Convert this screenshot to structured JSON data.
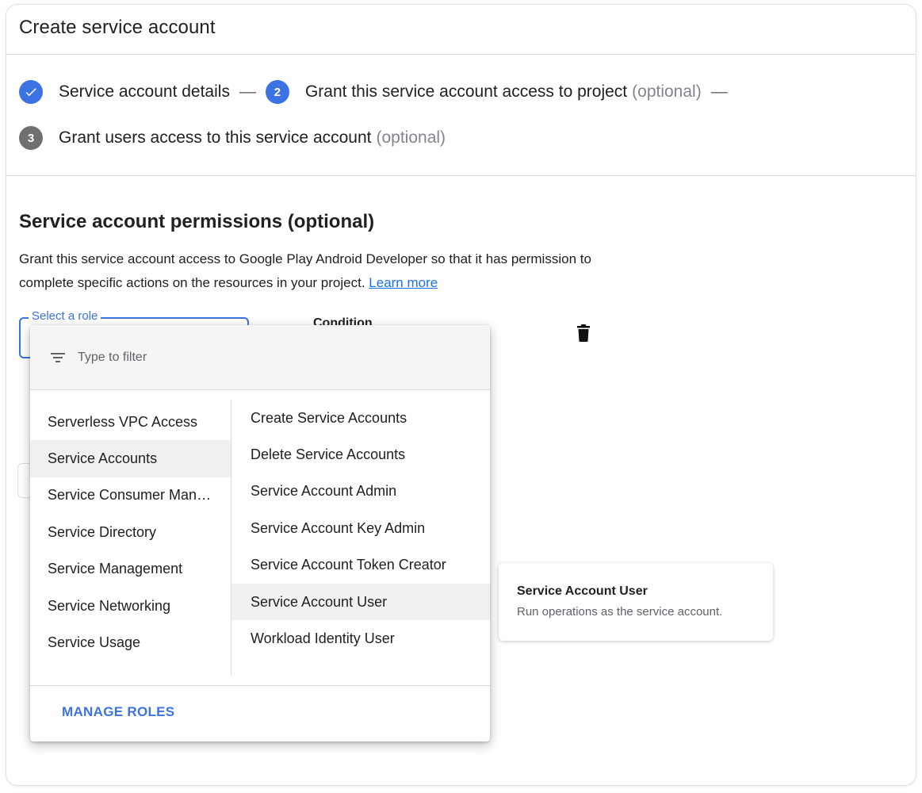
{
  "header": {
    "title": "Create service account"
  },
  "stepper": {
    "step1": {
      "label": "Service account details"
    },
    "separator": "—",
    "step2": {
      "number": "2",
      "label": "Grant this service account access to project",
      "optional": "(optional)"
    },
    "step3": {
      "number": "3",
      "label": "Grant users access to this service account",
      "optional": "(optional)"
    }
  },
  "permissions": {
    "title": "Service account permissions (optional)",
    "description": "Grant this service account access to Google Play Android Developer so that it has permission to complete specific actions on the resources in your project.",
    "learn_more": "Learn more",
    "role_label": "Select a role",
    "condition_label": "Condition"
  },
  "dropdown": {
    "filter_placeholder": "Type to filter",
    "services": [
      "Serverless VPC Access",
      "Service Accounts",
      "Service Consumer Man…",
      "Service Directory",
      "Service Management",
      "Service Networking",
      "Service Usage"
    ],
    "selected_service": "Service Accounts",
    "roles": [
      "Create Service Accounts",
      "Delete Service Accounts",
      "Service Account Admin",
      "Service Account Key Admin",
      "Service Account Token Creator",
      "Service Account User",
      "Workload Identity User"
    ],
    "selected_role": "Service Account User",
    "manage_roles": "MANAGE ROLES"
  },
  "tooltip": {
    "title": "Service Account User",
    "text": "Run operations as the service account."
  },
  "colors": {
    "accent": "#3b72e4",
    "link": "#1a73e8",
    "pending_step": "#6f6f6f"
  }
}
